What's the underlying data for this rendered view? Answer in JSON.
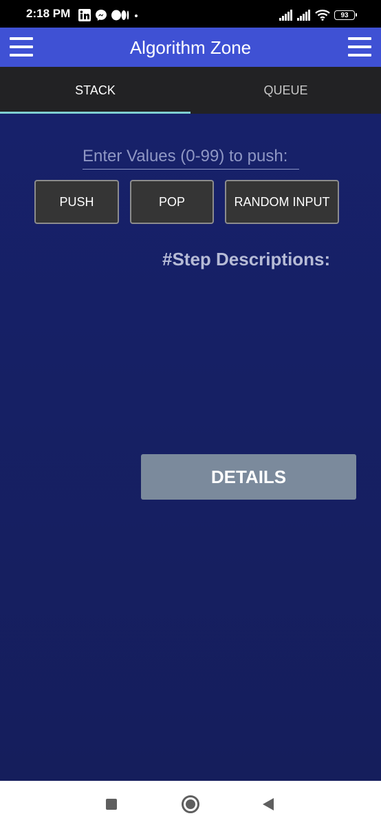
{
  "status_bar": {
    "time": "2:18 PM",
    "battery_level": "93",
    "left_icons": [
      "linkedin-icon",
      "messenger-icon",
      "medium-icon",
      "dot-icon"
    ],
    "right_icons": [
      "signal-icon",
      "signal-icon",
      "wifi-icon",
      "battery-icon"
    ]
  },
  "app_bar": {
    "title": "Algorithm Zone",
    "left_icon": "menu-icon",
    "right_icon": "menu-icon",
    "color": "#3f51d4"
  },
  "tabs": [
    {
      "label": "STACK",
      "selected": true
    },
    {
      "label": "QUEUE",
      "selected": false
    }
  ],
  "main": {
    "input_placeholder": "Enter Values (0-99) to push:",
    "input_value": "",
    "buttons": {
      "push": "PUSH",
      "pop": "POP",
      "random": "RANDOM INPUT"
    },
    "step_title": "#Step Descriptions:",
    "details_label": "DETAILS"
  },
  "nav_bar": {
    "icons": [
      "recents-icon",
      "home-icon",
      "back-icon"
    ]
  },
  "colors": {
    "background": "#17216a",
    "tab_indicator": "#7fcfd0",
    "details_button": "#7b8a9c"
  }
}
